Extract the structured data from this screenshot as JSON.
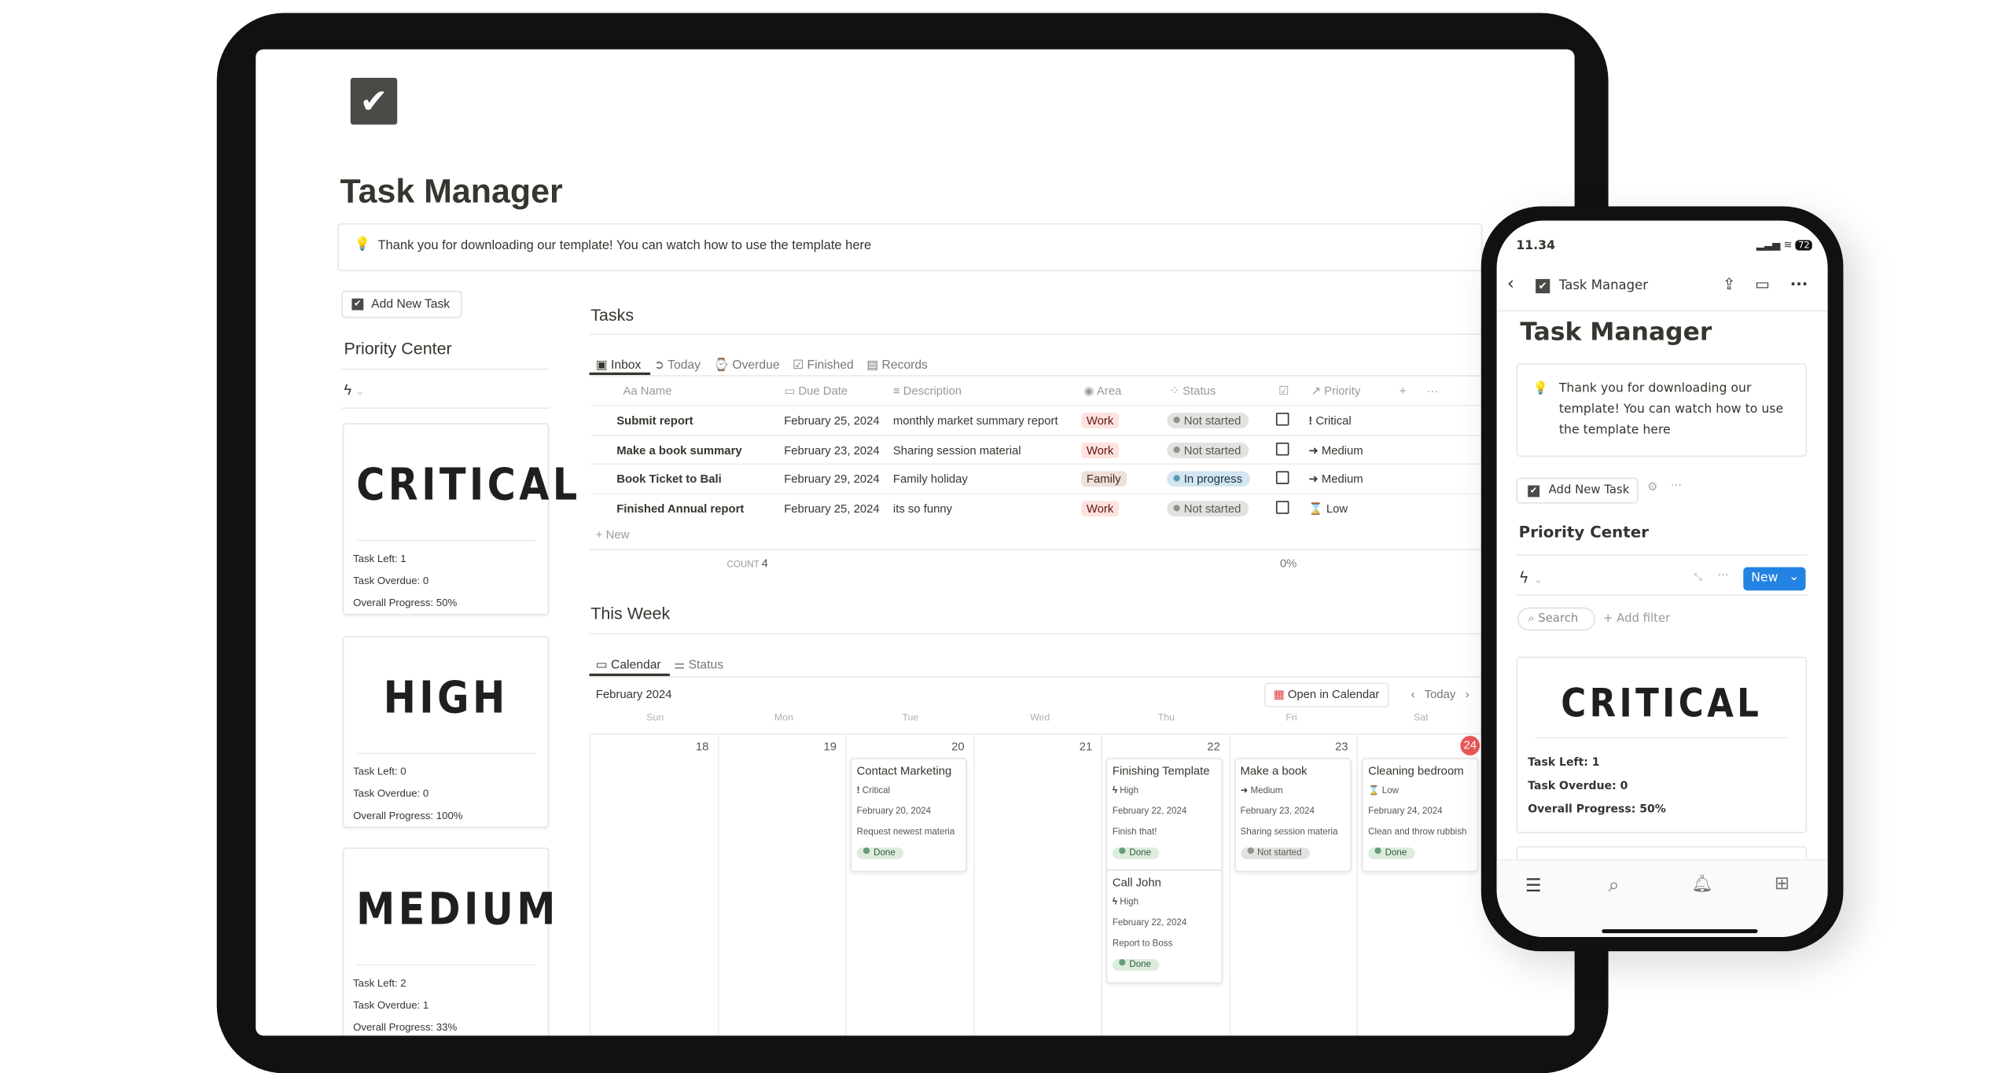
{
  "page": {
    "title": "Task Manager",
    "callout": "Thank you for downloading our template! You can watch how to use the template here",
    "add_task": "Add New Task",
    "priority_center": "Priority Center"
  },
  "priority_cards": [
    {
      "label": "CRITICAL",
      "task_left": "Task Left: 1",
      "task_overdue": "Task Overdue: 0",
      "progress": "Overall Progress: 50%"
    },
    {
      "label": "HIGH",
      "task_left": "Task Left: 0",
      "task_overdue": "Task Overdue: 0",
      "progress": "Overall Progress: 100%"
    },
    {
      "label": "MEDIUM",
      "task_left": "Task Left: 2",
      "task_overdue": "Task Overdue: 1",
      "progress": "Overall Progress: 33%"
    }
  ],
  "tasks": {
    "heading": "Tasks",
    "tabs": [
      "Inbox",
      "Today",
      "Overdue",
      "Finished",
      "Records"
    ],
    "columns": [
      "Name",
      "Due Date",
      "Description",
      "Area",
      "Status",
      "Priority"
    ],
    "rows": [
      {
        "name": "Submit report",
        "due": "February 25, 2024",
        "desc": "monthly market summary report",
        "area": "Work",
        "status": "Not started",
        "priority": "Critical",
        "priority_icon": "!"
      },
      {
        "name": "Make a book summary",
        "due": "February 23, 2024",
        "desc": "Sharing session material",
        "area": "Work",
        "status": "Not started",
        "priority": "Medium",
        "priority_icon": "➜"
      },
      {
        "name": "Book Ticket to Bali",
        "due": "February 29, 2024",
        "desc": "Family holiday",
        "area": "Family",
        "status": "In progress",
        "priority": "Medium",
        "priority_icon": "➜"
      },
      {
        "name": "Finished Annual report",
        "due": "February 25, 2024",
        "desc": "its so funny",
        "area": "Work",
        "status": "Not started",
        "priority": "Low",
        "priority_icon": "⌛"
      }
    ],
    "new_label": "New",
    "count_label": "COUNT",
    "count": "4",
    "percent": "0%"
  },
  "week": {
    "heading": "This Week",
    "tabs": [
      "Calendar",
      "Status"
    ],
    "month": "February 2024",
    "open_calendar": "Open in Calendar",
    "today": "Today",
    "days": [
      "Sun",
      "Mon",
      "Tue",
      "Wed",
      "Thu",
      "Fri",
      "Sat"
    ],
    "dates": [
      "18",
      "19",
      "20",
      "21",
      "22",
      "23",
      "24"
    ],
    "events": [
      {
        "title": "Contact Marketing",
        "priority": "Critical",
        "date": "February 20, 2024",
        "desc": "Request newest materia",
        "status": "Done"
      },
      {
        "title": "Finishing Template",
        "priority": "High",
        "date": "February 22, 2024",
        "desc": "Finish that!",
        "status": "Done"
      },
      {
        "title": "Call John",
        "priority": "High",
        "date": "February 22, 2024",
        "desc": "Report to Boss",
        "status": "Done"
      },
      {
        "title": "Make a book",
        "priority": "Medium",
        "date": "February 23, 2024",
        "desc": "Sharing session materia",
        "status": "Not started"
      },
      {
        "title": "Cleaning bedroom",
        "priority": "Low",
        "date": "February 24, 2024",
        "desc": "Clean and throw rubbish",
        "status": "Done"
      }
    ]
  },
  "phone": {
    "time": "11.34",
    "battery": "72",
    "nav_title": "Task Manager",
    "title": "Task Manager",
    "callout": "Thank you for downloading our template! You can watch how to use the template here",
    "add_task": "Add New Task",
    "priority_center": "Priority Center",
    "new": "New",
    "search": "Search",
    "add_filter": "Add filter",
    "card": {
      "label": "CRITICAL",
      "task_left": "Task Left: 1",
      "task_overdue": "Task Overdue: 0",
      "progress": "Overall Progress: 50%"
    }
  },
  "colors": {
    "work_bg": "#ffe2dd",
    "work_fg": "#5d1715",
    "family_bg": "#eee0da",
    "in_progress_bg": "#d3e5ef",
    "not_started_bg": "#e3e2e0",
    "done_bg": "#dbeddb",
    "accent_blue": "#2383e2",
    "today_red": "#eb5757"
  }
}
